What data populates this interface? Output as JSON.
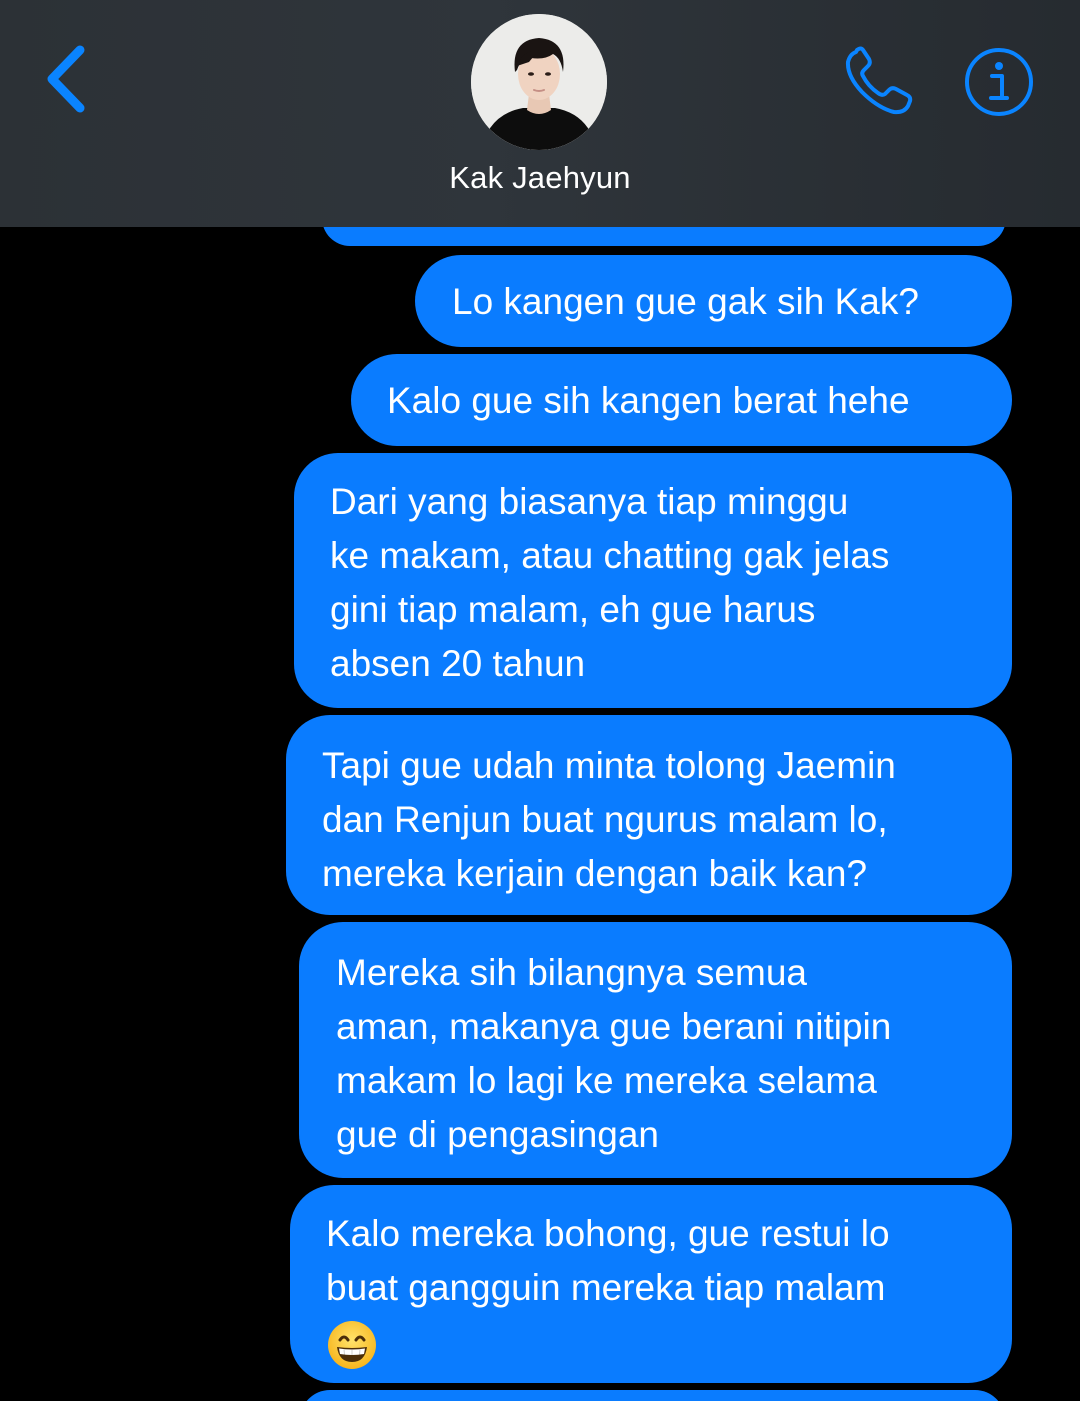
{
  "header": {
    "contact_name": "Kak Jaehyun",
    "back_icon": "chevron-left-icon",
    "call_icon": "phone-icon",
    "info_icon": "info-icon",
    "accent_color": "#0a7cff"
  },
  "messages": [
    {
      "text": "",
      "sender": "me",
      "partial": "top"
    },
    {
      "text": "Lo kangen gue gak sih Kak?",
      "sender": "me"
    },
    {
      "text": "Kalo gue sih kangen berat hehe",
      "sender": "me"
    },
    {
      "text": "Dari yang biasanya tiap minggu\nke makam, atau chatting gak jelas\ngini tiap malam, eh gue harus\nabsen 20 tahun",
      "sender": "me"
    },
    {
      "text": "Tapi gue udah minta tolong Jaemin\ndan Renjun buat ngurus malam lo,\nmereka kerjain dengan baik kan?",
      "sender": "me"
    },
    {
      "text": "Mereka sih bilangnya semua\naman, makanya gue berani nitipin\nmakam lo lagi ke mereka selama\ngue di pengasingan",
      "sender": "me"
    },
    {
      "text": "Kalo mereka bohong, gue restui lo\nbuat gangguin mereka tiap malam",
      "sender": "me",
      "emoji": "grinning-face-icon"
    },
    {
      "text": "",
      "sender": "me",
      "partial": "bottom"
    }
  ]
}
